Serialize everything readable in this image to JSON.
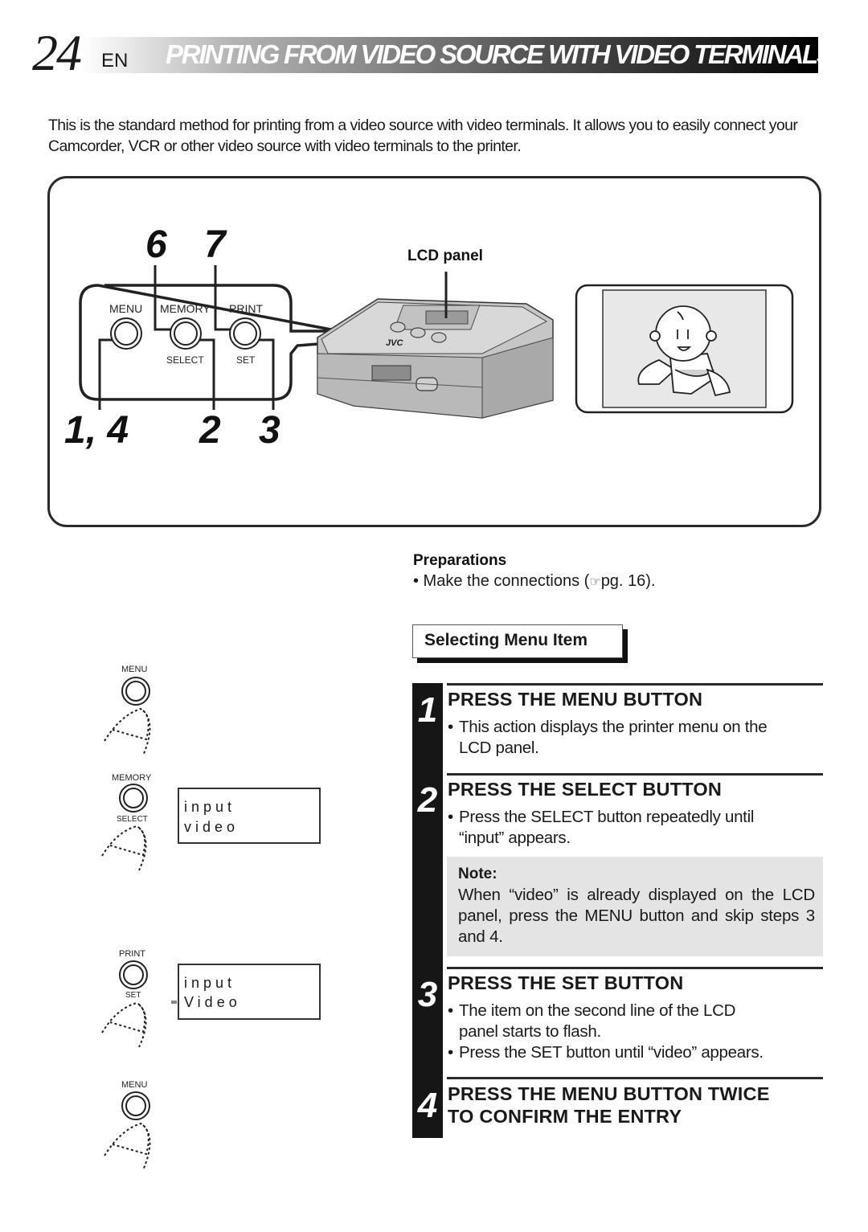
{
  "header": {
    "page_number": "24",
    "language": "EN",
    "title": "PRINTING FROM VIDEO SOURCE WITH VIDEO TERMINALS"
  },
  "intro": "This is the standard method for printing from a video source with video terminals. It allows you to easily connect your Camcorder, VCR or other video source with video terminals to the printer.",
  "diagram": {
    "callouts_top": [
      "6",
      "7"
    ],
    "callouts_bottom": [
      "1, 4",
      "2",
      "3"
    ],
    "buttons": [
      {
        "top_label": "MENU",
        "bottom_label": ""
      },
      {
        "top_label": "MEMORY",
        "bottom_label": "SELECT"
      },
      {
        "top_label": "PRINT",
        "bottom_label": "SET"
      }
    ],
    "lcd_panel_label": "LCD panel",
    "brand": "JVC"
  },
  "preparations": {
    "title": "Preparations",
    "item_prefix": "• Make the connections (",
    "item_ref_icon": "☞",
    "item_suffix": "pg. 16)."
  },
  "section_title": "Selecting Menu Item",
  "steps": [
    {
      "number": "1",
      "title": "PRESS THE MENU BUTTON",
      "bullets": [
        [
          "This action displays the printer menu on the",
          "LCD panel."
        ]
      ]
    },
    {
      "number": "2",
      "title": "PRESS THE SELECT BUTTON",
      "bullets": [
        [
          "Press the SELECT button repeatedly until",
          "“input” appears."
        ]
      ]
    },
    {
      "number": "3",
      "title": "PRESS THE SET BUTTON",
      "bullets": [
        [
          "The item on the second line of the LCD",
          "panel starts to flash."
        ],
        [
          "Press the SET button until “video” appears."
        ]
      ]
    },
    {
      "number": "4",
      "title_lines": [
        "PRESS THE MENU BUTTON TWICE",
        "TO CONFIRM THE ENTRY"
      ]
    }
  ],
  "note": {
    "title": "Note:",
    "text": "When “video” is already displayed on the LCD panel, press the MENU button and skip steps 3 and 4."
  },
  "left_illustrations": [
    {
      "top_label": "MENU",
      "bottom_label": ""
    },
    {
      "top_label": "MEMORY",
      "bottom_label": "SELECT",
      "lcd": [
        "input",
        "video"
      ]
    },
    {
      "top_label": "PRINT",
      "bottom_label": "SET",
      "lcd": [
        "input",
        "Video"
      ],
      "flashing": true
    },
    {
      "top_label": "MENU",
      "bottom_label": ""
    }
  ]
}
